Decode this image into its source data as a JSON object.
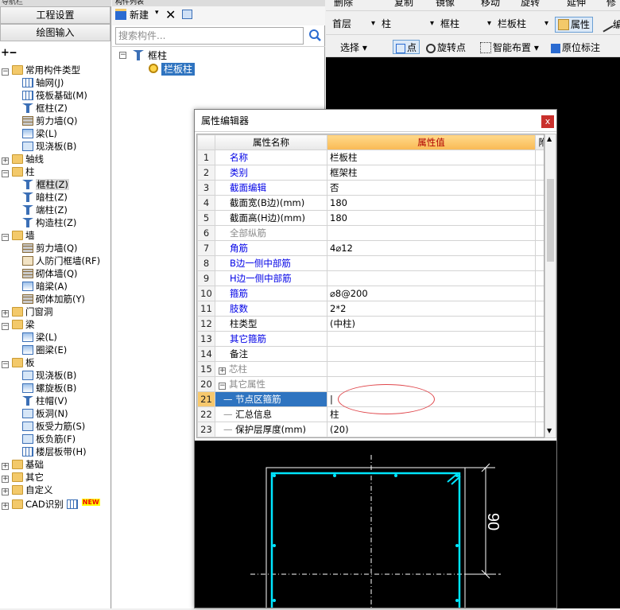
{
  "nav": {
    "title": "导航栏",
    "project_settings": "工程设置",
    "drawing_input": "绘图输入",
    "tree": [
      {
        "label": "常用构件类型",
        "icon": "folder-icon",
        "level": 0,
        "expander": "-"
      },
      {
        "label": "轴网(J)",
        "icon": "grid-icon",
        "level": 1
      },
      {
        "label": "筏板基础(M)",
        "icon": "raft-icon",
        "level": 1
      },
      {
        "label": "框柱(Z)",
        "icon": "column-icon",
        "level": 1
      },
      {
        "label": "剪力墙(Q)",
        "icon": "wall-icon",
        "level": 1
      },
      {
        "label": "梁(L)",
        "icon": "beam-icon",
        "level": 1
      },
      {
        "label": "现浇板(B)",
        "icon": "slab-icon",
        "level": 1
      },
      {
        "label": "轴线",
        "icon": "folder-icon",
        "level": 0,
        "expander": "+"
      },
      {
        "label": "柱",
        "icon": "folder-icon",
        "level": 0,
        "expander": "-"
      },
      {
        "label": "框柱(Z)",
        "icon": "column-icon",
        "level": 1,
        "selected": true
      },
      {
        "label": "暗柱(Z)",
        "icon": "column-icon",
        "level": 1
      },
      {
        "label": "端柱(Z)",
        "icon": "column-icon",
        "level": 1
      },
      {
        "label": "构造柱(Z)",
        "icon": "column-icon",
        "level": 1
      },
      {
        "label": "墙",
        "icon": "folder-icon",
        "level": 0,
        "expander": "-"
      },
      {
        "label": "剪力墙(Q)",
        "icon": "wall-icon",
        "level": 1
      },
      {
        "label": "人防门框墙(RF)",
        "icon": "door-icon",
        "level": 1
      },
      {
        "label": "砌体墙(Q)",
        "icon": "wall-icon",
        "level": 1
      },
      {
        "label": "暗梁(A)",
        "icon": "beam-icon",
        "level": 1
      },
      {
        "label": "砌体加筋(Y)",
        "icon": "rebar-icon",
        "level": 1
      },
      {
        "label": "门窗洞",
        "icon": "folder-icon",
        "level": 0,
        "expander": "+"
      },
      {
        "label": "梁",
        "icon": "folder-icon",
        "level": 0,
        "expander": "-"
      },
      {
        "label": "梁(L)",
        "icon": "beam-icon",
        "level": 1
      },
      {
        "label": "圈梁(E)",
        "icon": "beam-icon",
        "level": 1
      },
      {
        "label": "板",
        "icon": "folder-icon",
        "level": 0,
        "expander": "-"
      },
      {
        "label": "现浇板(B)",
        "icon": "slab-icon",
        "level": 1
      },
      {
        "label": "螺旋板(B)",
        "icon": "spiral-icon",
        "level": 1
      },
      {
        "label": "柱帽(V)",
        "icon": "cap-icon",
        "level": 1
      },
      {
        "label": "板洞(N)",
        "icon": "slab-icon",
        "level": 1
      },
      {
        "label": "板受力筋(S)",
        "icon": "slab-icon",
        "level": 1
      },
      {
        "label": "板负筋(F)",
        "icon": "slab-icon",
        "level": 1
      },
      {
        "label": "楼层板带(H)",
        "icon": "grid-icon",
        "level": 1
      },
      {
        "label": "基础",
        "icon": "folder-icon",
        "level": 0,
        "expander": "+"
      },
      {
        "label": "其它",
        "icon": "folder-icon",
        "level": 0,
        "expander": "+"
      },
      {
        "label": "自定义",
        "icon": "folder-icon",
        "level": 0,
        "expander": "+"
      },
      {
        "label": "CAD识别",
        "icon": "folder-icon",
        "level": 0,
        "expander": "+",
        "badge": "NEW"
      }
    ]
  },
  "comp": {
    "title": "构件列表",
    "new_label": "新建",
    "search_placeholder": "搜索构件...",
    "tree_root": "框柱",
    "tree_child": "栏板柱"
  },
  "toolbar": {
    "row1": [
      "删除",
      "复制",
      "镜像",
      "移动",
      "旋转",
      "延伸",
      "修"
    ],
    "floor": "首层",
    "type": "柱",
    "subtype": "框柱",
    "component": "栏板柱",
    "property_btn": "属性",
    "edit_btn": "编",
    "row3": [
      "选择",
      "点",
      "旋转点",
      "智能布置",
      "原位标注"
    ]
  },
  "dialog": {
    "title": "属性编辑器",
    "close": "x",
    "headers": {
      "name": "属性名称",
      "value": "属性值",
      "extra": "附加"
    },
    "rows": [
      {
        "idx": "1",
        "name": "名称",
        "value": "栏板柱",
        "style": "blue",
        "check": false
      },
      {
        "idx": "2",
        "name": "类别",
        "value": "框架柱",
        "style": "blue",
        "check": true
      },
      {
        "idx": "3",
        "name": "截面编辑",
        "value": "否",
        "style": "blue",
        "check": false
      },
      {
        "idx": "4",
        "name": "截面宽(B边)(mm)",
        "value": "180",
        "style": "plain",
        "check": true
      },
      {
        "idx": "5",
        "name": "截面高(H边)(mm)",
        "value": "180",
        "style": "plain",
        "check": true
      },
      {
        "idx": "6",
        "name": "全部纵筋",
        "value": "",
        "style": "gray",
        "check": true
      },
      {
        "idx": "7",
        "name": "角筋",
        "value": "4⌀12",
        "style": "blue",
        "check": true
      },
      {
        "idx": "8",
        "name": "B边一侧中部筋",
        "value": "",
        "style": "blue",
        "check": true
      },
      {
        "idx": "9",
        "name": "H边一侧中部筋",
        "value": "",
        "style": "blue",
        "check": true
      },
      {
        "idx": "10",
        "name": "箍筋",
        "value": "⌀8@200",
        "style": "blue",
        "check": true
      },
      {
        "idx": "11",
        "name": "肢数",
        "value": "2*2",
        "style": "blue",
        "check": false
      },
      {
        "idx": "12",
        "name": "柱类型",
        "value": "(中柱)",
        "style": "plain",
        "check": true
      },
      {
        "idx": "13",
        "name": "其它箍筋",
        "value": "",
        "style": "blue",
        "check": false
      },
      {
        "idx": "14",
        "name": "备注",
        "value": "",
        "style": "plain",
        "check": true
      },
      {
        "idx": "15",
        "name": "芯柱",
        "value": "",
        "style": "gray",
        "check": false,
        "expander": "+"
      },
      {
        "idx": "20",
        "name": "其它属性",
        "value": "",
        "style": "gray",
        "check": false,
        "expander": "-"
      },
      {
        "idx": "21",
        "name": "节点区箍筋",
        "value": "|",
        "style": "sub",
        "check": true,
        "selected": true
      },
      {
        "idx": "22",
        "name": "汇总信息",
        "value": "柱",
        "style": "sub",
        "check": true
      },
      {
        "idx": "23",
        "name": "保护层厚度(mm)",
        "value": "(20)",
        "style": "sub",
        "check": true
      }
    ]
  },
  "preview": {
    "dimension_label": "90"
  }
}
